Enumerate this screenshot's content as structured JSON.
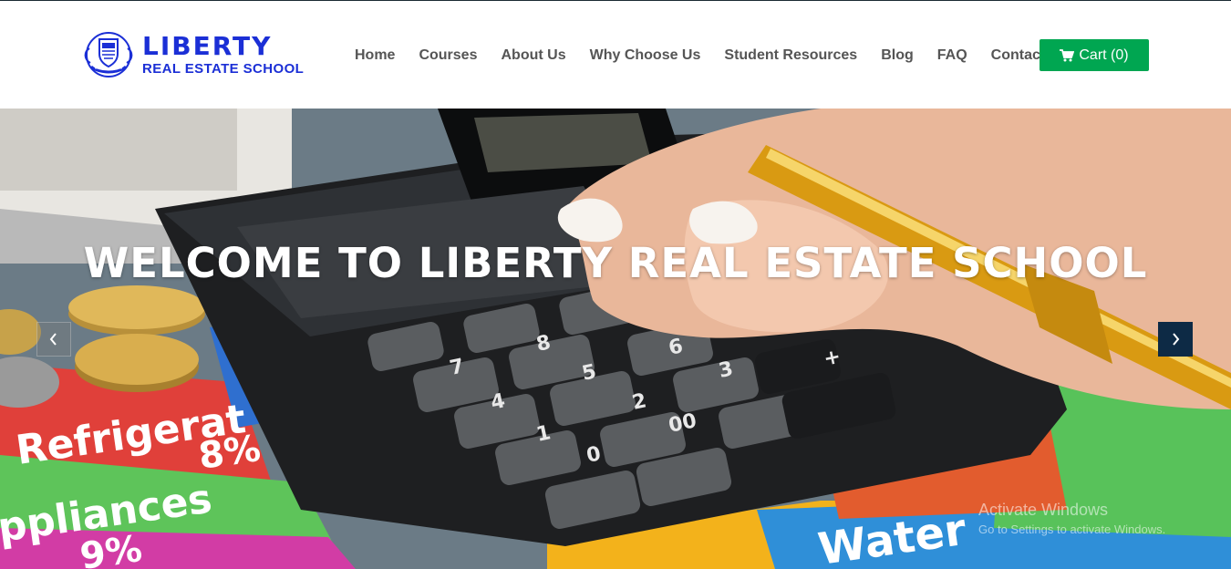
{
  "brand": {
    "name": "LIBERTY",
    "tagline": "REAL ESTATE SCHOOL"
  },
  "nav": {
    "items": [
      {
        "label": "Home"
      },
      {
        "label": "Courses"
      },
      {
        "label": "About Us"
      },
      {
        "label": "Why Choose Us"
      },
      {
        "label": "Student Resources"
      },
      {
        "label": "Blog"
      },
      {
        "label": "FAQ"
      },
      {
        "label": "Contact us"
      }
    ],
    "cart_label": "Cart (0)"
  },
  "hero": {
    "title": "WELCOME TO LIBERTY REAL ESTATE SCHOOL",
    "slide_image": "calculator-and-pen-photo",
    "background_text": [
      "Refrigerat",
      "8%",
      "ppliances",
      "9%",
      "Water"
    ]
  },
  "colors": {
    "brand_blue": "#1b2fd6",
    "nav_text": "#555555",
    "cart_green": "#00a651",
    "arrow_dark": "#0d2a45"
  },
  "os_watermark": {
    "title": "Activate Windows",
    "subtitle": "Go to Settings to activate Windows."
  }
}
